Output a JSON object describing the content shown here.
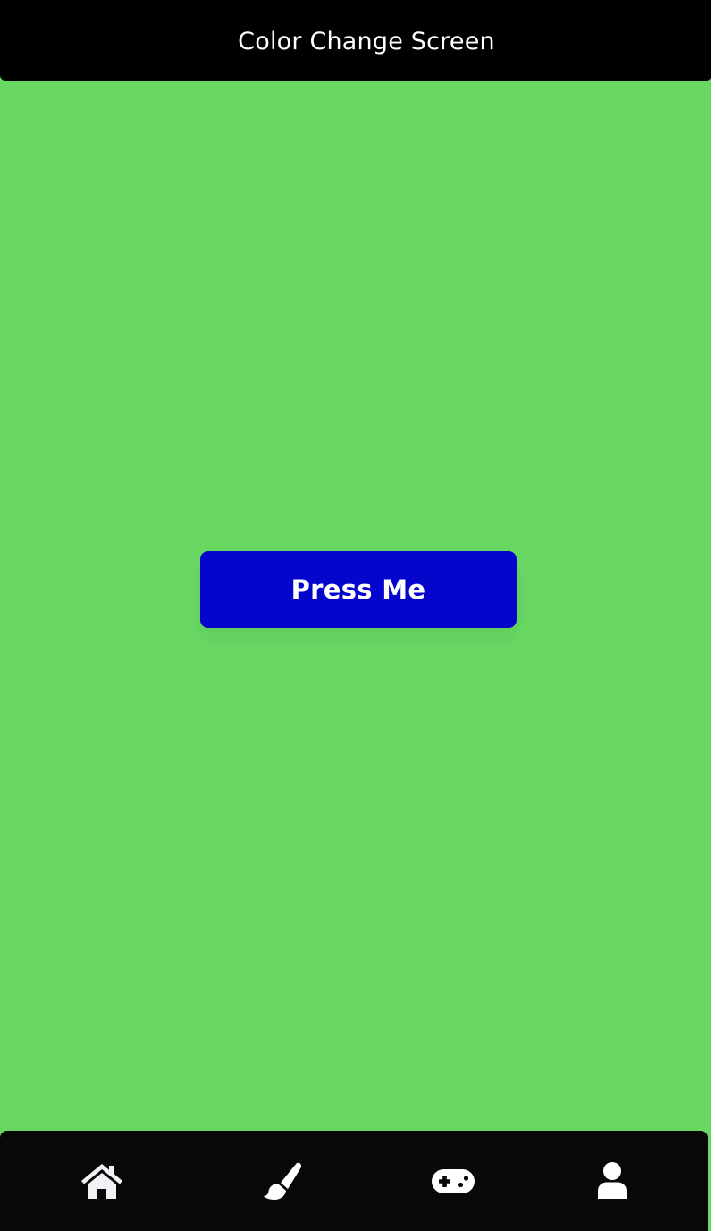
{
  "header": {
    "title": "Color Change Screen"
  },
  "main": {
    "background_color": "#68d863",
    "button_label": "Press Me",
    "button_color": "#0505cc"
  },
  "tabbar": {
    "items": [
      {
        "icon": "home-icon"
      },
      {
        "icon": "paintbrush-icon"
      },
      {
        "icon": "gamepad-icon"
      },
      {
        "icon": "user-icon"
      }
    ]
  }
}
